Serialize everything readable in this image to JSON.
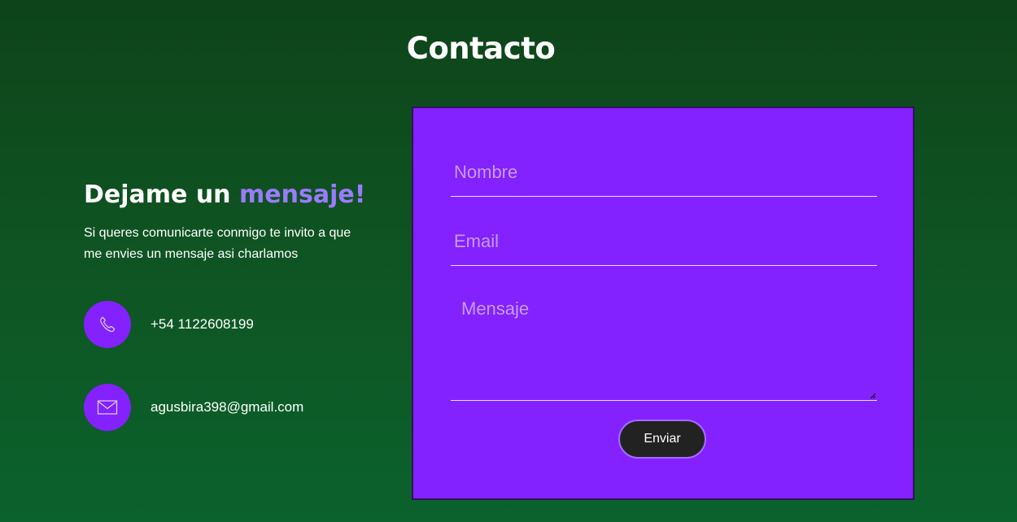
{
  "header": {
    "title": "Contacto"
  },
  "intro": {
    "heading_start": "Dejame un ",
    "heading_accent": "mensaje!",
    "subtitle": "Si queres comunicarte conmigo te invito a que me envies un mensaje asi charlamos"
  },
  "contacts": [
    {
      "icon": "phone-icon",
      "text": "+54 1122608199"
    },
    {
      "icon": "mail-icon",
      "text": "agusbira398@gmail.com"
    }
  ],
  "form": {
    "name_placeholder": "Nombre",
    "email_placeholder": "Email",
    "message_placeholder": "Mensaje",
    "submit_label": "Enviar"
  },
  "colors": {
    "accent": "#8321ff",
    "accent_text": "#9a7bff",
    "background_top": "#0d4419",
    "background_bottom": "#0b622c",
    "button": "#222222"
  }
}
